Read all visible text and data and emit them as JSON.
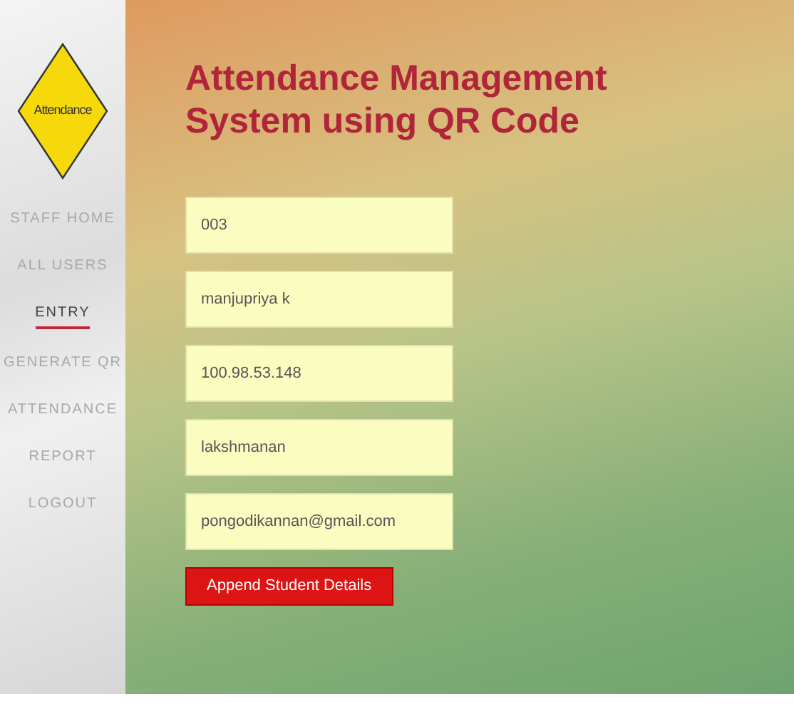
{
  "sidebar": {
    "logo_text": "Attendance",
    "items": [
      {
        "label": "STAFF HOME",
        "selected": false
      },
      {
        "label": "ALL USERS",
        "selected": false
      },
      {
        "label": "ENTRY",
        "selected": true
      },
      {
        "label": "GENERATE QR",
        "selected": false
      },
      {
        "label": "ATTENDANCE",
        "selected": false
      },
      {
        "label": "REPORT",
        "selected": false
      },
      {
        "label": "LOGOUT",
        "selected": false
      }
    ]
  },
  "main": {
    "title": "Attendance Management System using QR Code",
    "fields": [
      {
        "value": "003"
      },
      {
        "value": "manjupriya k"
      },
      {
        "value": "100.98.53.148"
      },
      {
        "value": "lakshmanan"
      },
      {
        "value": "pongodikannan@gmail.com"
      }
    ],
    "button": "Append Student Details"
  }
}
